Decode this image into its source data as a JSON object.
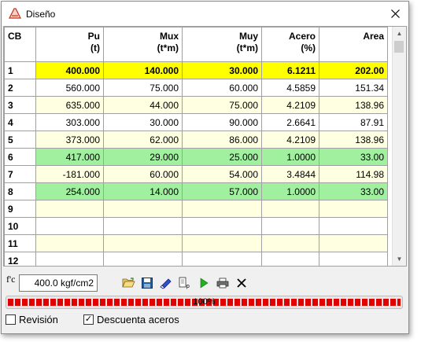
{
  "window": {
    "title": "Diseño"
  },
  "table": {
    "headers": [
      {
        "line1": "CB",
        "line2": ""
      },
      {
        "line1": "Pu",
        "line2": "(t)"
      },
      {
        "line1": "Mux",
        "line2": "(t*m)"
      },
      {
        "line1": "Muy",
        "line2": "(t*m)"
      },
      {
        "line1": "Acero",
        "line2": "(%)"
      },
      {
        "line1": "Area",
        "line2": ""
      }
    ],
    "rows": [
      [
        "1",
        "400.000",
        "140.000",
        "30.000",
        "6.1211",
        "202.00"
      ],
      [
        "2",
        "560.000",
        "75.000",
        "60.000",
        "4.5859",
        "151.34"
      ],
      [
        "3",
        "635.000",
        "44.000",
        "75.000",
        "4.2109",
        "138.96"
      ],
      [
        "4",
        "303.000",
        "30.000",
        "90.000",
        "2.6641",
        "87.91"
      ],
      [
        "5",
        "373.000",
        "62.000",
        "86.000",
        "4.2109",
        "138.96"
      ],
      [
        "6",
        "417.000",
        "29.000",
        "25.000",
        "1.0000",
        "33.00"
      ],
      [
        "7",
        "-181.000",
        "60.000",
        "54.000",
        "3.4844",
        "114.98"
      ],
      [
        "8",
        "254.000",
        "14.000",
        "57.000",
        "1.0000",
        "33.00"
      ],
      [
        "9",
        "",
        "",
        "",
        "",
        ""
      ],
      [
        "10",
        "",
        "",
        "",
        "",
        ""
      ],
      [
        "11",
        "",
        "",
        "",
        "",
        ""
      ],
      [
        "12",
        "",
        "",
        "",
        "",
        ""
      ]
    ],
    "row_styles": [
      "yellow",
      "white",
      "cream",
      "white",
      "cream",
      "green",
      "cream",
      "green",
      "cream",
      "white",
      "cream",
      "white"
    ]
  },
  "footer": {
    "fc_label": "f'c",
    "fc_value": "400.0 kgf/cm2",
    "progress_text": "100%",
    "progress_value": 1.0,
    "checkbox_revision": {
      "label": "Revisión",
      "checked": false
    },
    "checkbox_descuenta": {
      "label": "Descuenta aceros",
      "checked": true
    }
  },
  "icons": [
    "folder-open-icon",
    "save-icon",
    "eraser-icon",
    "report-icon",
    "play-icon",
    "print-icon",
    "close-x-icon"
  ],
  "colors": {
    "highlight_yellow": "#ffff00",
    "highlight_green": "#a0f0a0",
    "cream": "#ffffe1",
    "progress_red": "#e00000"
  }
}
